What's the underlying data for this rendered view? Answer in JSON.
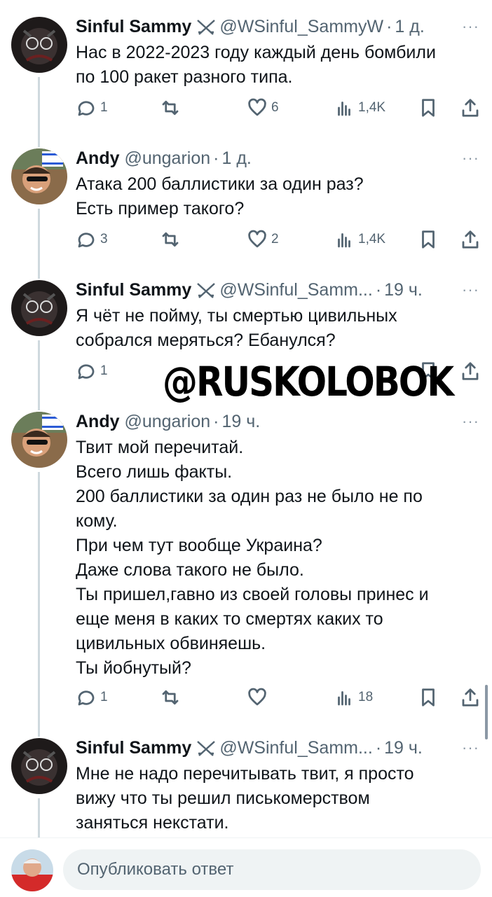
{
  "tweets": [
    {
      "author": "Sinful Sammy",
      "handle": "@WSinful_SammyW",
      "dot": "·",
      "time": "1 д.",
      "lines": [
        "Нас в 2022-2023 году каждый день бомбили",
        "по 100 ракет разного типа."
      ],
      "replies": "1",
      "retweets": "",
      "likes": "6",
      "views": "1,4K"
    },
    {
      "author": "Andy",
      "handle": "@ungarion",
      "dot": "·",
      "time": "1 д.",
      "lines": [
        "Атака 200 баллистики за один раз?",
        "Есть пример такого?"
      ],
      "replies": "3",
      "retweets": "",
      "likes": "2",
      "views": "1,4K"
    },
    {
      "author": "Sinful Sammy",
      "handle": "@WSinful_Samm...",
      "dot": "·",
      "time": "19 ч.",
      "lines": [
        "Я чёт не пойму, ты смертью цивильных",
        "собрался меряться? Ебанулся?"
      ],
      "replies": "1",
      "retweets": "",
      "likes": "",
      "views": ""
    },
    {
      "author": "Andy",
      "handle": "@ungarion",
      "dot": "·",
      "time": "19 ч.",
      "lines": [
        "Твит мой перечитай.",
        "Всего лишь факты.",
        "200 баллистики за один раз не было не по",
        "кому.",
        "При чем тут вообще Украина?",
        "Даже слова такого не было.",
        "Ты пришел,гавно из своей головы принес и",
        "еще меня в каких то смертях каких то",
        "цивильных обвиняешь.",
        "Ты йобнутый?"
      ],
      "replies": "1",
      "retweets": "",
      "likes": "",
      "views": "18"
    },
    {
      "author": "Sinful Sammy",
      "handle": "@WSinful_Samm...",
      "dot": "·",
      "time": "19 ч.",
      "lines": [
        "Мне не надо перечитывать твит, я просто",
        "вижу что ты решил писькомерством",
        "заняться некстати."
      ]
    }
  ],
  "more_label": "···",
  "watermark": "@RUSKOLOBOK",
  "reply_placeholder": "Опубликовать ответ",
  "colors": {
    "text": "#0f1419",
    "secondary": "#536471",
    "thread_line": "#cfd9de",
    "input_bg": "#eff3f4"
  }
}
